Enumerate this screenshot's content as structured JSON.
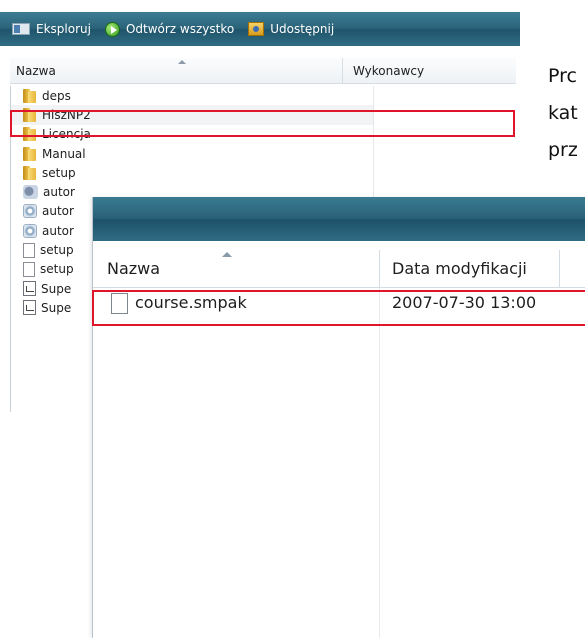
{
  "window1": {
    "toolbar": {
      "explore_label": "Eksploruj",
      "play_all_label": "Odtwórz wszystko",
      "share_label": "Udostępnij"
    },
    "columns": {
      "name": "Nazwa",
      "artists": "Wykonawcy"
    },
    "items": [
      {
        "label": "deps",
        "icon": "folder-icon"
      },
      {
        "label": "HiszNP2",
        "icon": "folder-icon"
      },
      {
        "label": "Licencja",
        "icon": "folder-icon"
      },
      {
        "label": "Manual",
        "icon": "folder-icon"
      },
      {
        "label": "setup",
        "icon": "folder-icon"
      },
      {
        "label": "autor",
        "icon": "autorun-icon"
      },
      {
        "label": "autor",
        "icon": "config-file-icon"
      },
      {
        "label": "autor",
        "icon": "config-file-icon"
      },
      {
        "label": "setup",
        "icon": "document-icon"
      },
      {
        "label": "setup",
        "icon": "document-icon"
      },
      {
        "label": "Supe",
        "icon": "chart-file-icon"
      },
      {
        "label": "Supe",
        "icon": "chart-file-icon"
      }
    ]
  },
  "side_text": {
    "line1": "Prc",
    "line2": "kat",
    "line3": "prz"
  },
  "window2": {
    "columns": {
      "name": "Nazwa",
      "modified": "Data modyfikacji"
    },
    "file": {
      "name": "course.smpak",
      "modified": "2007-07-30 13:00",
      "icon": "document-icon"
    }
  },
  "colors": {
    "toolbar": "#2b6379",
    "highlight": "#e0142b"
  }
}
